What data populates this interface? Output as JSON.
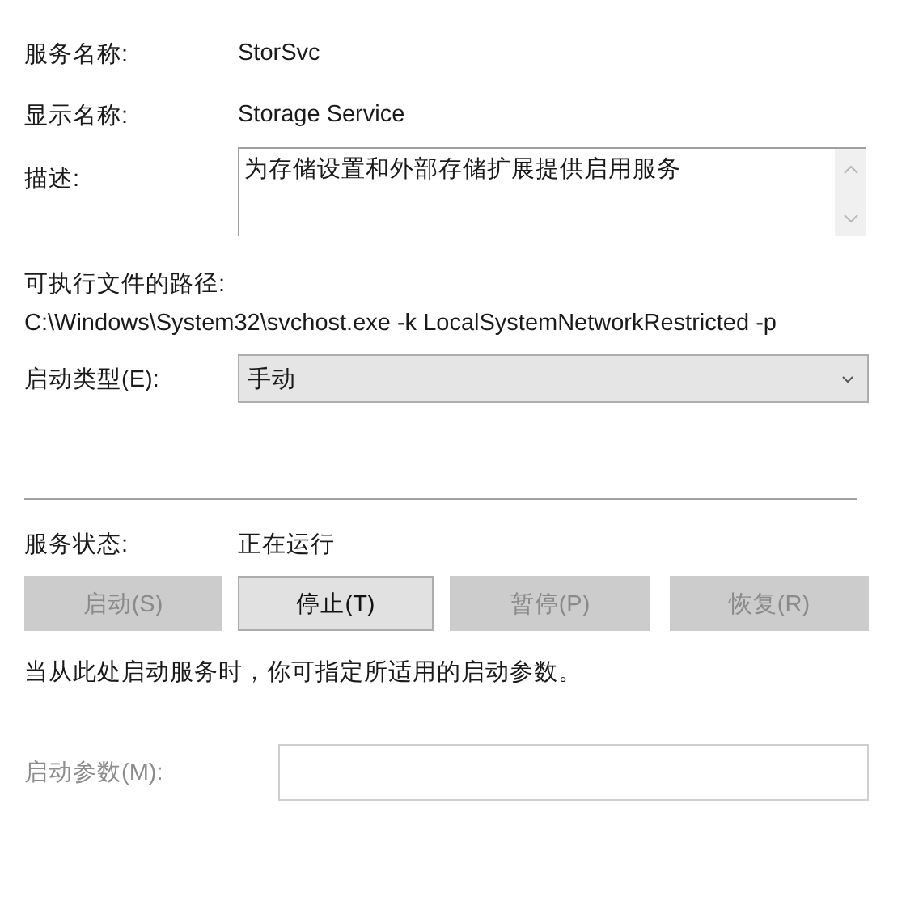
{
  "service_name": {
    "label": "服务名称:",
    "value": "StorSvc"
  },
  "display_name": {
    "label": "显示名称:",
    "value": "Storage Service"
  },
  "description": {
    "label": "描述:",
    "value": "为存储设置和外部存储扩展提供启用服务"
  },
  "executable_path": {
    "label": "可执行文件的路径:",
    "value": "C:\\Windows\\System32\\svchost.exe -k LocalSystemNetworkRestricted -p"
  },
  "startup_type": {
    "label": "启动类型(E):",
    "value": "手动"
  },
  "service_status": {
    "label": "服务状态:",
    "value": "正在运行"
  },
  "buttons": [
    {
      "label": "启动(S)",
      "disabled": true
    },
    {
      "label": "停止(T)",
      "disabled": false
    },
    {
      "label": "暂停(P)",
      "disabled": true
    },
    {
      "label": "恢复(R)",
      "disabled": true
    }
  ],
  "note": "当从此处启动服务时，你可指定所适用的启动参数。",
  "start_parameters": {
    "label": "启动参数(M):",
    "disabled": true
  }
}
